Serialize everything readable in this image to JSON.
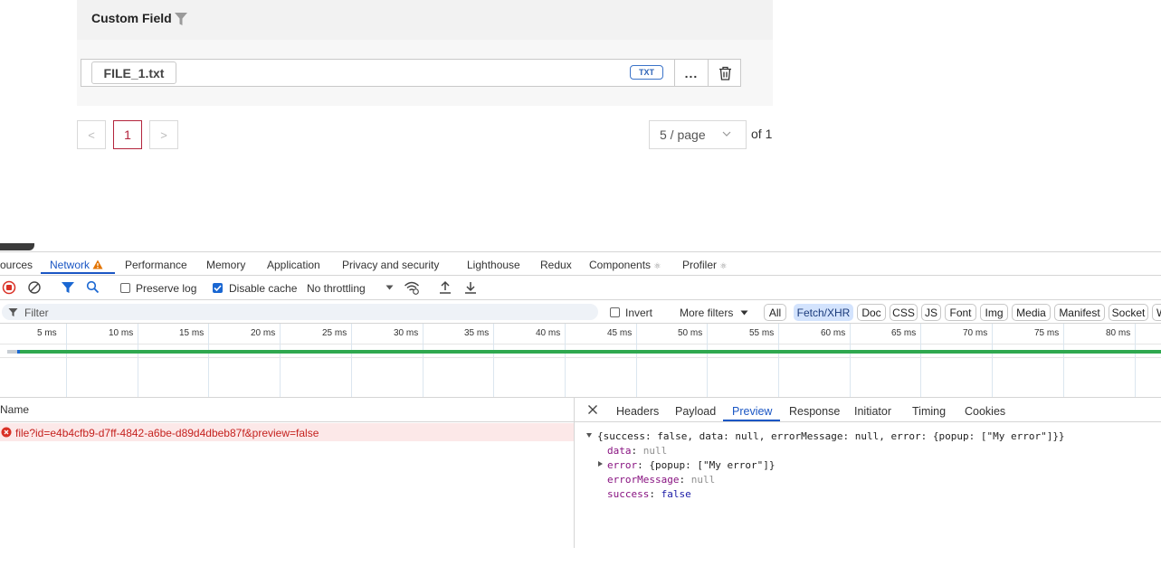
{
  "app": {
    "section_title": "Custom Field",
    "file": {
      "name": "FILE_1.txt",
      "type_badge": "TXT",
      "more_label": "..."
    },
    "pagination": {
      "prev": "<",
      "current": "1",
      "next": ">",
      "page_size": "5 / page",
      "of_label": "of 1"
    }
  },
  "devtools": {
    "tabs": [
      "ources",
      "Network",
      "Performance",
      "Memory",
      "Application",
      "Privacy and security",
      "Lighthouse",
      "Redux",
      "Components",
      "Profiler"
    ],
    "active_tab": "Network",
    "toolbar": {
      "preserve_log": "Preserve log",
      "disable_cache": "Disable cache",
      "throttling": "No throttling"
    },
    "filter": {
      "placeholder": "Filter",
      "invert": "Invert",
      "more_filters": "More filters",
      "types": [
        "All",
        "Fetch/XHR",
        "Doc",
        "CSS",
        "JS",
        "Font",
        "Img",
        "Media",
        "Manifest",
        "Socket",
        "W"
      ],
      "active_type": "Fetch/XHR"
    },
    "timeline_ticks": [
      "5 ms",
      "10 ms",
      "15 ms",
      "20 ms",
      "25 ms",
      "30 ms",
      "35 ms",
      "40 ms",
      "45 ms",
      "50 ms",
      "55 ms",
      "60 ms",
      "65 ms",
      "70 ms",
      "75 ms",
      "80 ms"
    ],
    "requests": {
      "column_name": "Name",
      "rows": [
        "file?id=e4b4cfb9-d7ff-4842-a6be-d89d4dbeb87f&preview=false"
      ]
    },
    "detail_tabs": [
      "Headers",
      "Payload",
      "Preview",
      "Response",
      "Initiator",
      "Timing",
      "Cookies"
    ],
    "active_detail_tab": "Preview",
    "preview": {
      "summary": "{success: false, data: null, errorMessage: null, error: {popup: [\"My error\"]}}",
      "fields": [
        {
          "key": "data",
          "value": "null",
          "kind": "null",
          "expandable": false
        },
        {
          "key": "error",
          "value": "{popup: [\"My error\"]}",
          "kind": "object",
          "expandable": true
        },
        {
          "key": "errorMessage",
          "value": "null",
          "kind": "null",
          "expandable": false
        },
        {
          "key": "success",
          "value": "false",
          "kind": "bool",
          "expandable": false
        }
      ]
    }
  },
  "colors": {
    "accent_blue": "#1a56c4",
    "error_red": "#c5221f",
    "page_active": "#b3243c",
    "timeline_green": "#2fa84f"
  }
}
